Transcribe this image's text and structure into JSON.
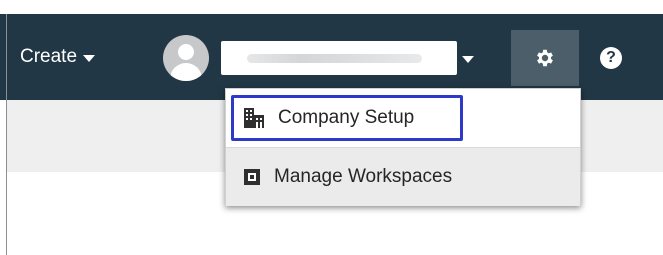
{
  "navbar": {
    "create_label": "Create",
    "user_name": "",
    "settings_icon": "gear-icon",
    "help_icon": "question-icon",
    "help_glyph": "?"
  },
  "menu": {
    "items": [
      {
        "label": "Company Setup",
        "icon": "building-icon",
        "highlighted": true
      },
      {
        "label": "Manage Workspaces",
        "icon": "workspace-icon",
        "highlighted": false
      }
    ]
  },
  "colors": {
    "navbar": "#223745",
    "settings_button": "#4c5e6a",
    "highlight_border": "#2e39c9",
    "subbar": "#efefef"
  }
}
